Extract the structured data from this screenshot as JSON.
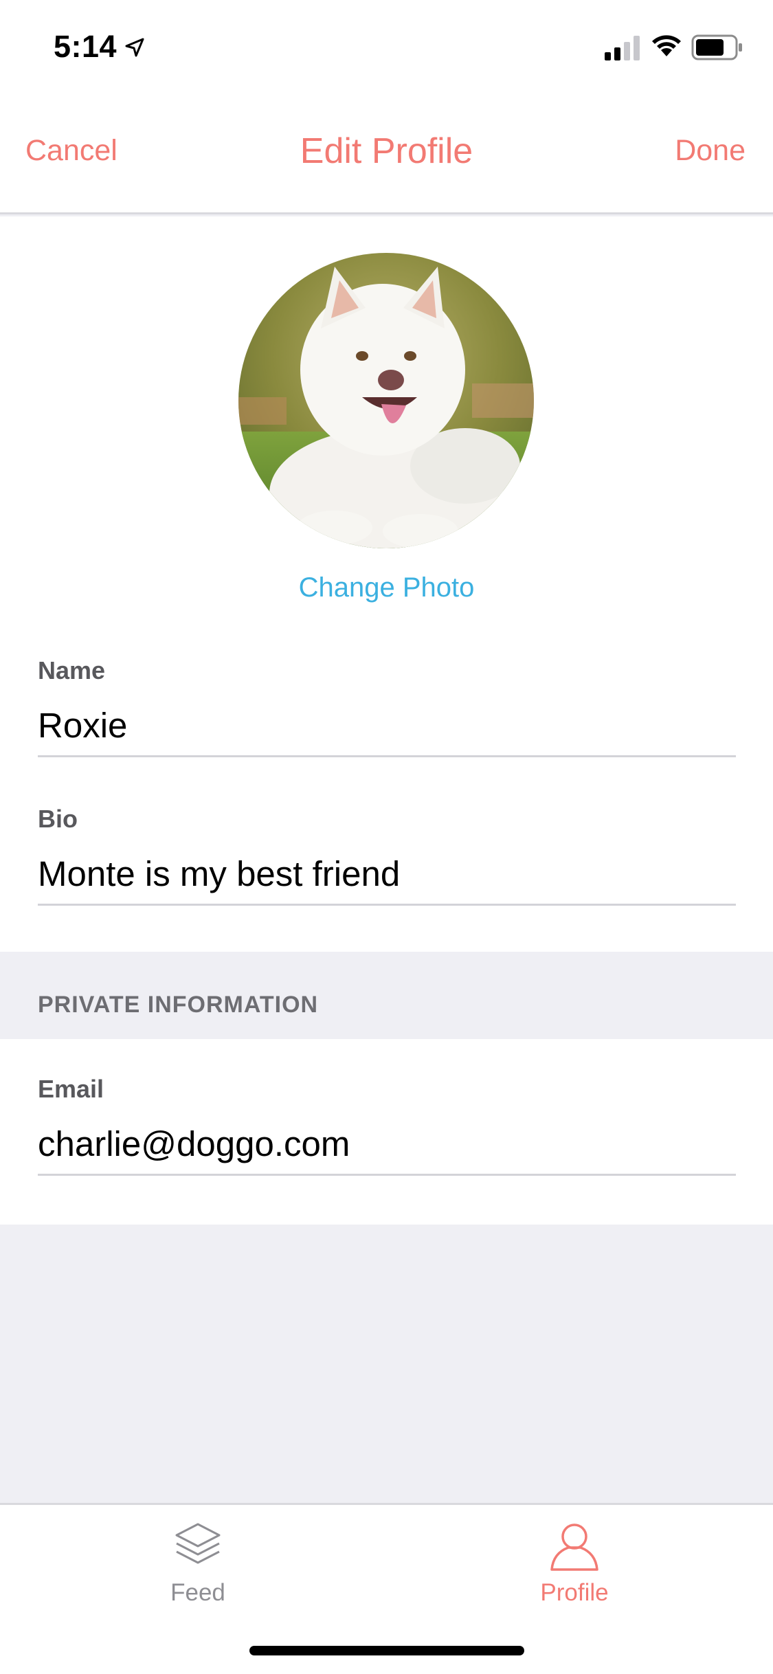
{
  "status_bar": {
    "time": "5:14",
    "icons": [
      "location-arrow-icon",
      "cellular-signal-icon",
      "wifi-icon",
      "battery-icon"
    ]
  },
  "nav": {
    "cancel_label": "Cancel",
    "title": "Edit Profile",
    "done_label": "Done"
  },
  "profile": {
    "avatar_description": "white-dog-photo",
    "change_photo_label": "Change Photo"
  },
  "fields": {
    "name": {
      "label": "Name",
      "value": "Roxie"
    },
    "bio": {
      "label": "Bio",
      "value": "Monte is my best friend"
    }
  },
  "private_section": {
    "header": "PRIVATE INFORMATION",
    "email": {
      "label": "Email",
      "value": "charlie@doggo.com"
    }
  },
  "tab_bar": {
    "tabs": [
      {
        "label": "Feed",
        "icon": "layers-icon",
        "active": false
      },
      {
        "label": "Profile",
        "icon": "person-icon",
        "active": true
      }
    ]
  },
  "colors": {
    "accent": "#f27a73",
    "link": "#3bb0e0",
    "grouped_background": "#efeff4",
    "inactive_tab": "#8e8e93"
  }
}
